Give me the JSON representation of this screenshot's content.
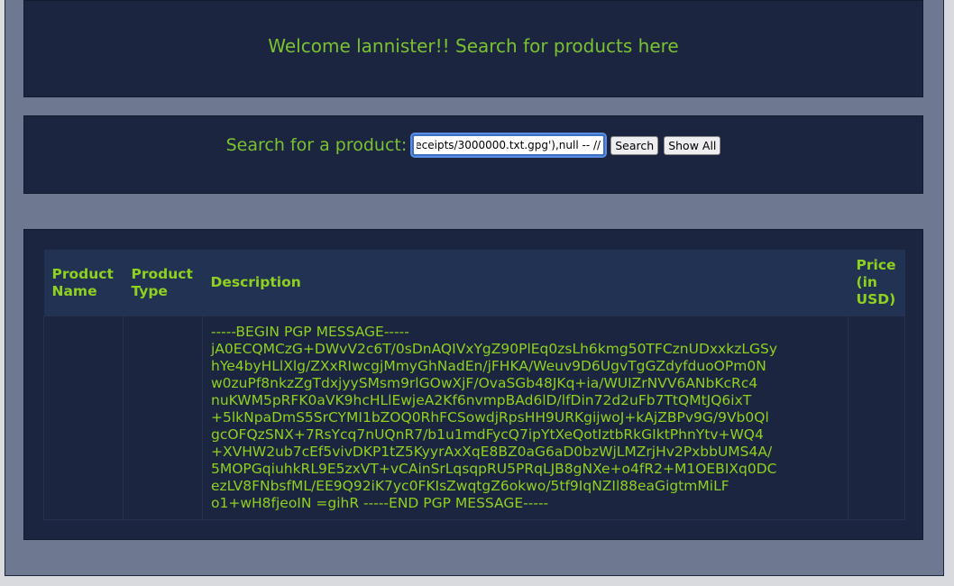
{
  "header": {
    "title": "Welcome lannister!! Search for products here"
  },
  "search": {
    "label": "Search for a product:",
    "value": "eceipts/3000000.txt.gpg'),null -- //",
    "search_button": "Search",
    "show_all_button": "Show All"
  },
  "table": {
    "columns": [
      "Product Name",
      "Product Type",
      "Description",
      "Price (in USD)"
    ],
    "rows": [
      {
        "name": "",
        "type": "",
        "price": "",
        "description_lines": [
          "-----BEGIN PGP MESSAGE-----",
          "jA0ECQMCzG+DWvV2c6T/0sDnAQIVxYgZ90PlEq0zsLh6kmg50TFCznUDxxkzLGSy",
          "hYe4byHLlXlg/ZXxRIwcgjMmyGhNadEn/jFHKA/Weuv9D6UgvTgGZdyfduoOPm0N",
          "w0zuPf8nkzZgTdxjyySMsm9rlGOwXjF/OvaSGb48JKq+ia/WUIZrNVV6ANbKcRc4",
          "nuKWM5pRFK0aVK9hcHLlEwjeA2Kf6nvmpBAd6lD/lfDin72d2uFb7TtQMtJQ6ixT",
          "+5lkNpaDmS5SrCYMI1bZOQ0RhFCSowdjRpsHH9URKgijwoJ+kAjZBPv9G/9Vb0Ql",
          "gcOFQzSNX+7RsYcq7nUQnR7/b1u1mdFycQ7ipYtXeQotIztbRkGIktPhnYtv+WQ4",
          "+XVHW2ub7cEf5vivDKP1tZ5KyyrAxXqE8BZ0aG6aD0bzWjLMZrjHv2PxbbUMS4A/",
          "5MOPGqiuhkRL9E5zxVT+vCAinSrLqsqpRU5PRqLJB8gNXe+o4fR2+M1OEBIXq0DC",
          "ezLV8FNbsfML/EE9Q92iK7yc0FKIsZwqtgZ6okwo/5tf9IqNZIl88eaGigtmMiLF",
          "o1+wH8fjeoIN =gihR -----END PGP MESSAGE-----"
        ]
      }
    ]
  }
}
